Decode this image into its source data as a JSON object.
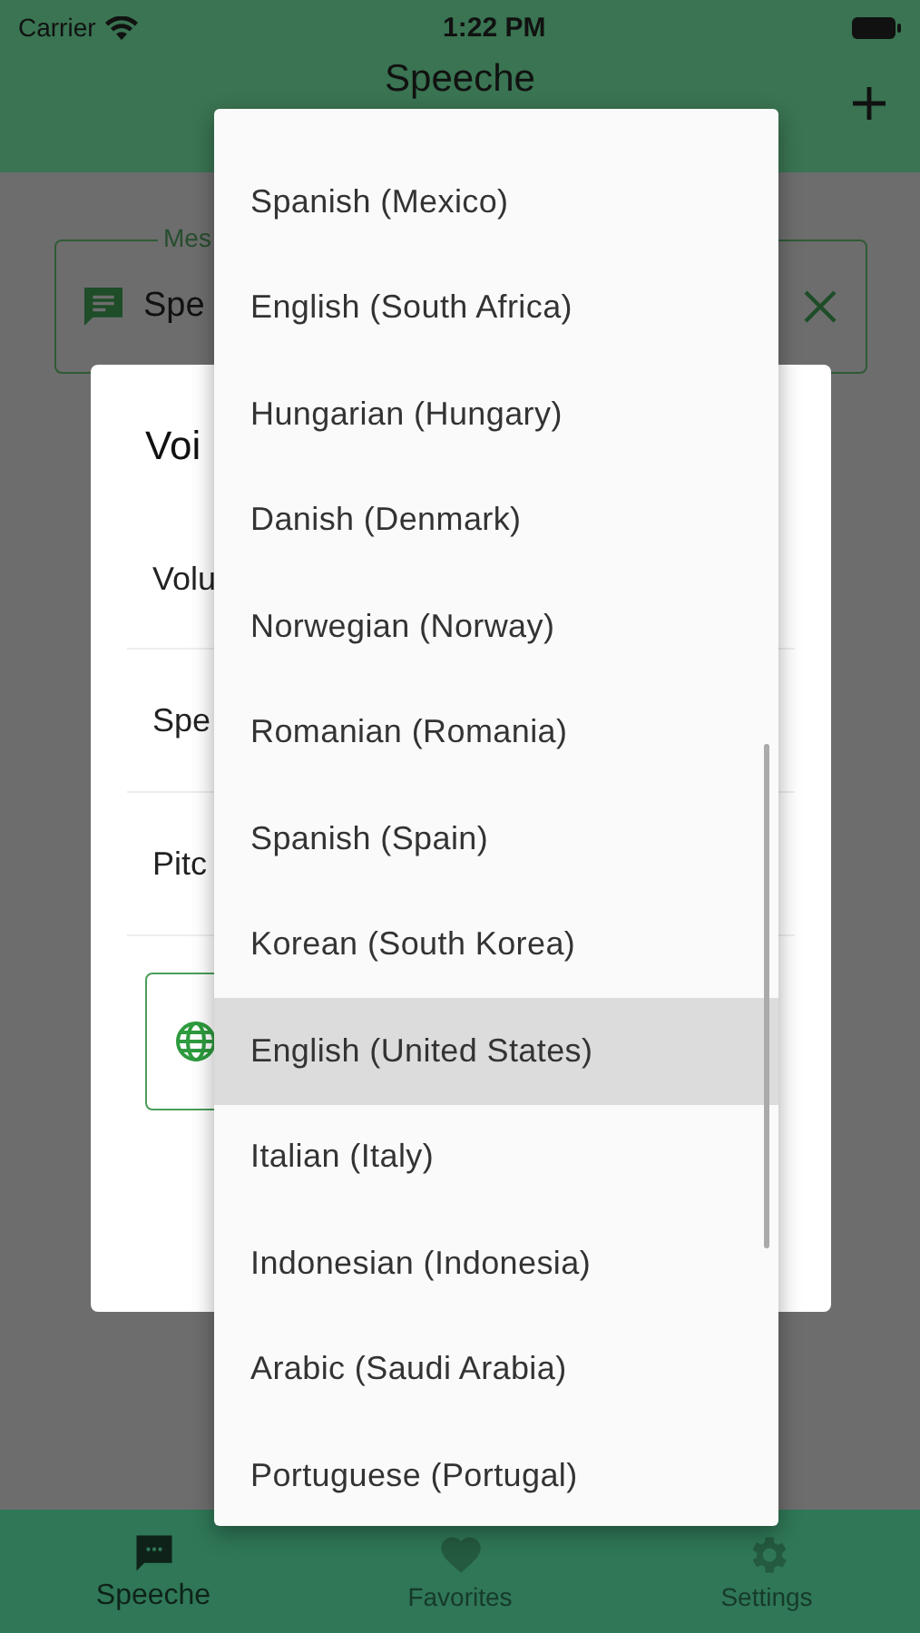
{
  "status_bar": {
    "carrier": "Carrier",
    "time": "1:22 PM"
  },
  "app_bar": {
    "title": "Speeche"
  },
  "message_field": {
    "label": "Mes",
    "value": "Spe"
  },
  "dialog": {
    "title": "Voi",
    "rows": [
      {
        "label": "Volu"
      },
      {
        "label": "Spe"
      },
      {
        "label": "Pitc"
      }
    ]
  },
  "language_menu": {
    "items": [
      {
        "label": "Spanish (Mexico)",
        "selected": false
      },
      {
        "label": "English (South Africa)",
        "selected": false
      },
      {
        "label": "Hungarian (Hungary)",
        "selected": false
      },
      {
        "label": "Danish (Denmark)",
        "selected": false
      },
      {
        "label": "Norwegian (Norway)",
        "selected": false
      },
      {
        "label": "Romanian (Romania)",
        "selected": false
      },
      {
        "label": "Spanish (Spain)",
        "selected": false
      },
      {
        "label": "Korean (South Korea)",
        "selected": false
      },
      {
        "label": "English (United States)",
        "selected": true
      },
      {
        "label": "Italian (Italy)",
        "selected": false
      },
      {
        "label": "Indonesian (Indonesia)",
        "selected": false
      },
      {
        "label": "Arabic (Saudi Arabia)",
        "selected": false
      },
      {
        "label": "Portuguese (Portugal)",
        "selected": false
      }
    ]
  },
  "bottom_nav": [
    {
      "label": "Speeche",
      "kind": "chat",
      "selected": true
    },
    {
      "label": "Favorites",
      "kind": "heart",
      "selected": false
    },
    {
      "label": "Settings",
      "kind": "gear",
      "selected": false
    }
  ]
}
